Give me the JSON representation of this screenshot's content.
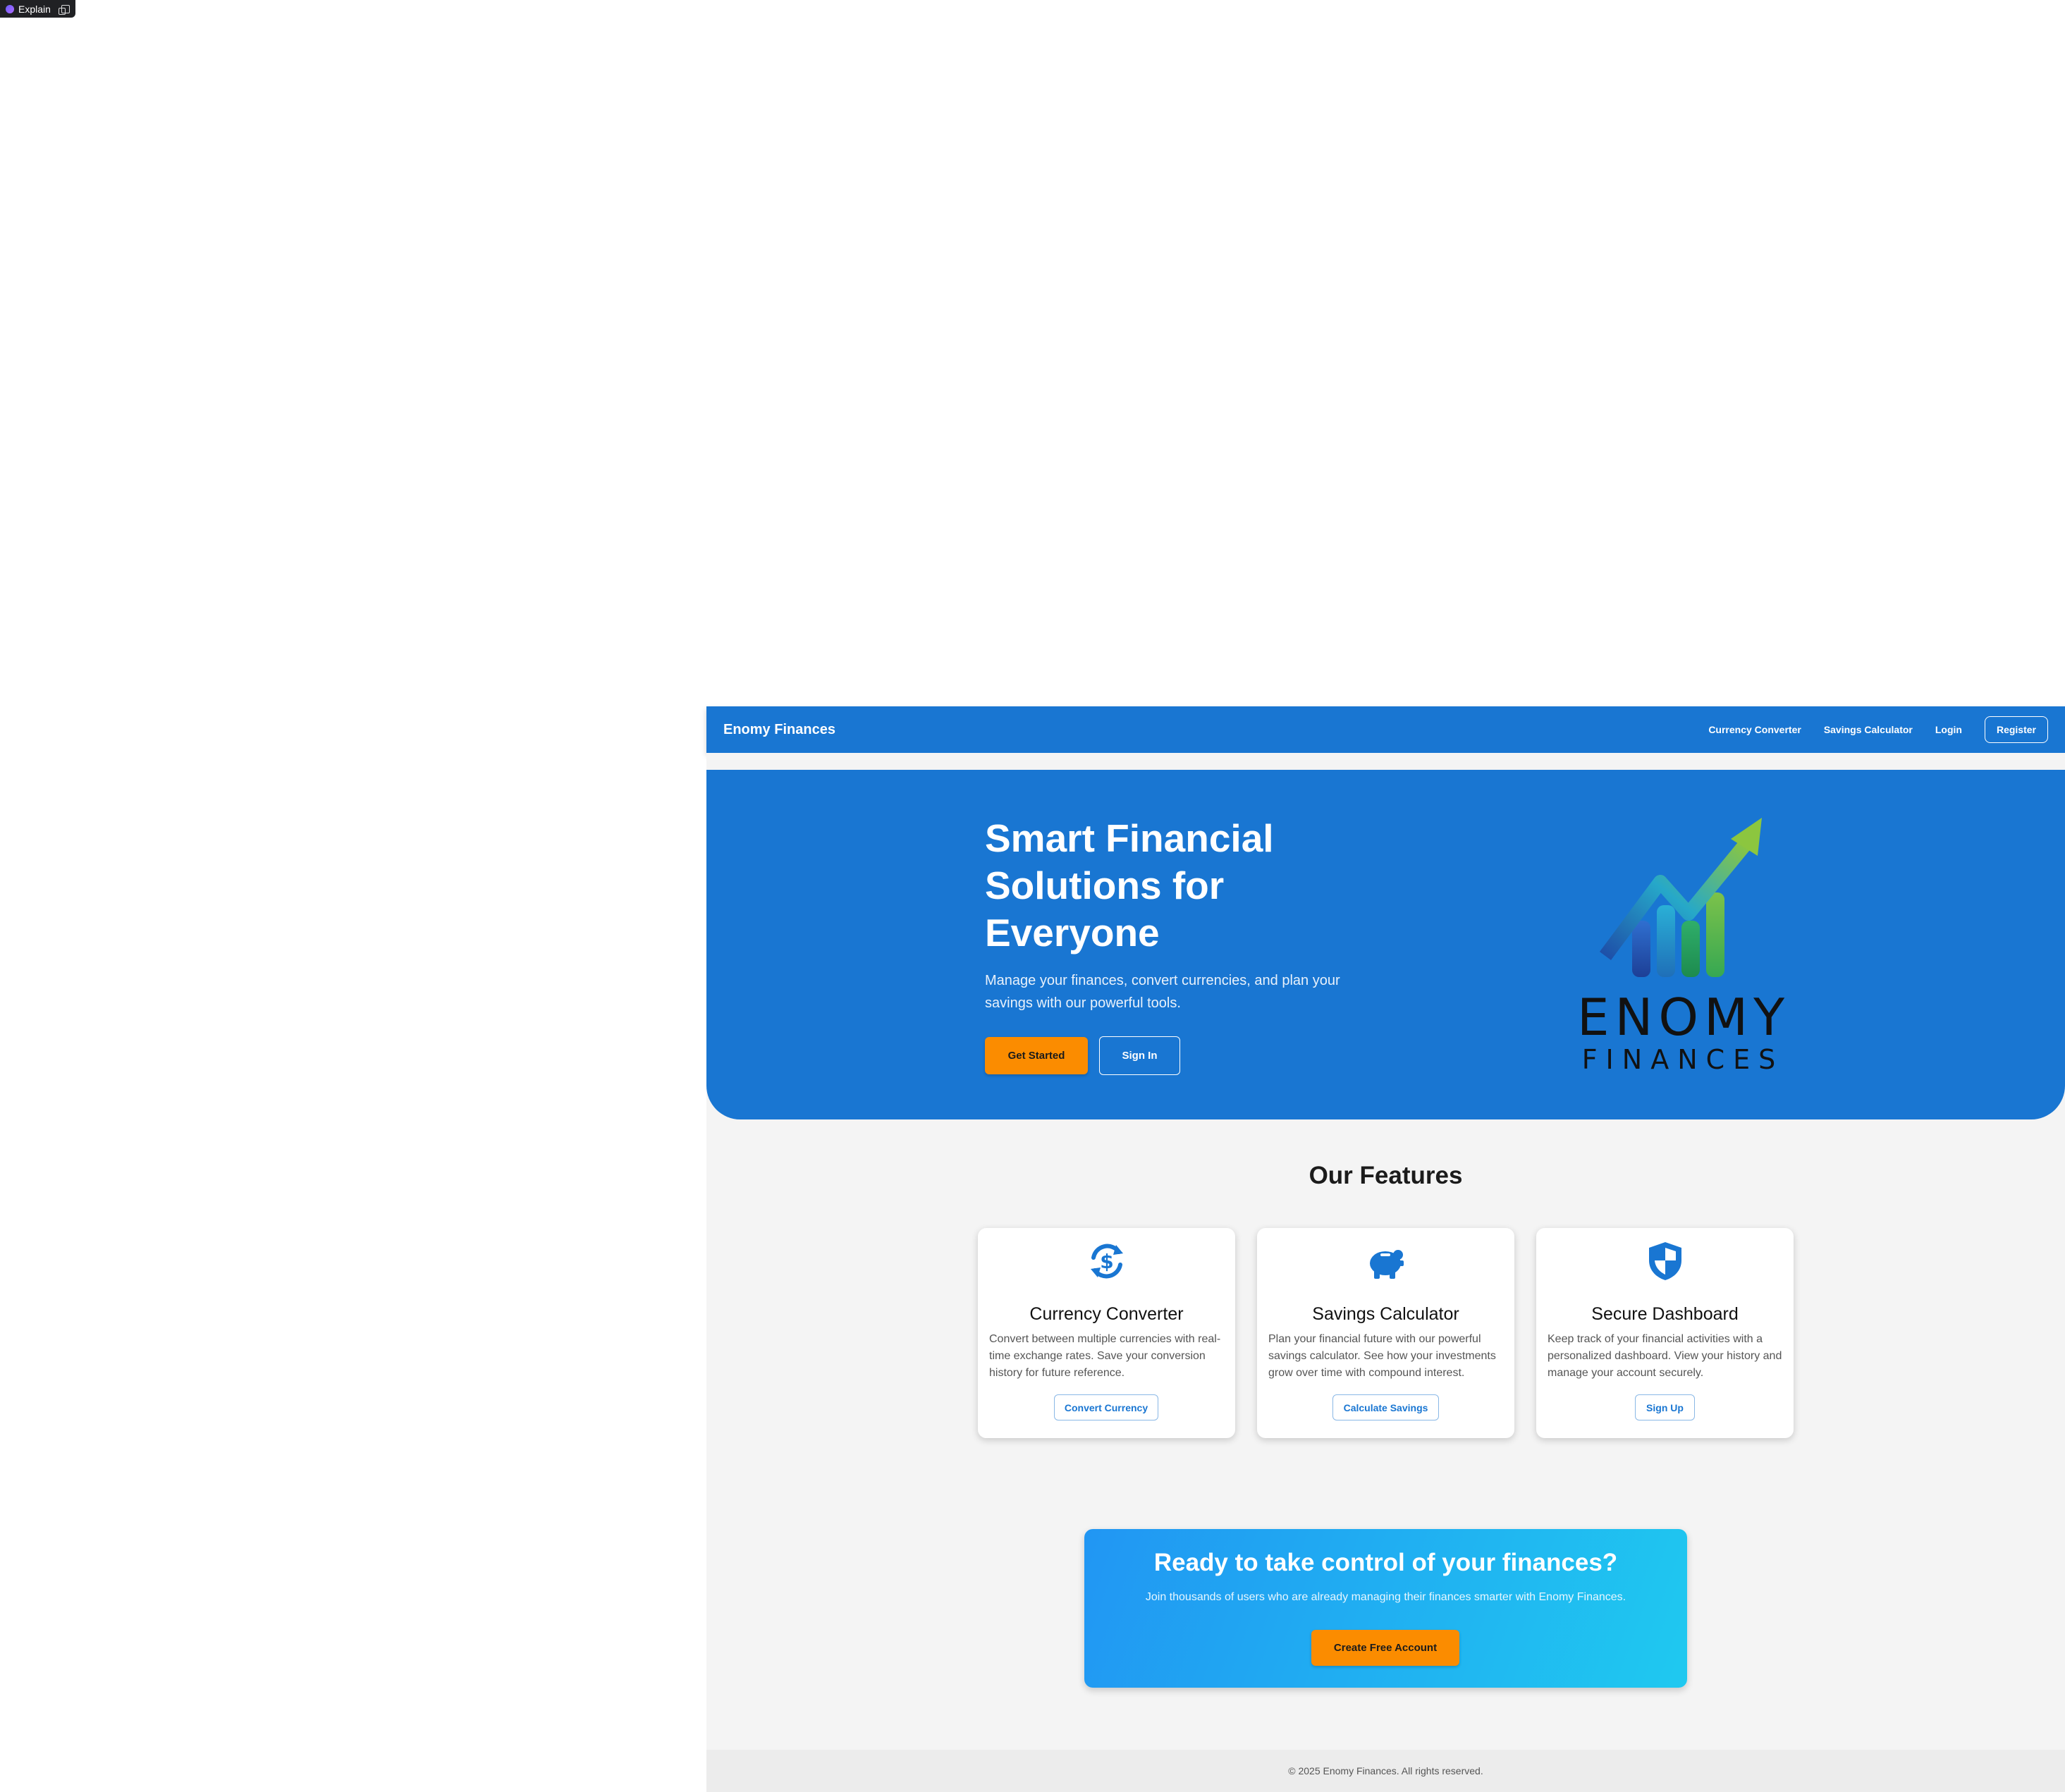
{
  "explain_badge": {
    "label": "Explain",
    "icon": "copy-icon"
  },
  "navbar": {
    "brand": "Enomy Finances",
    "links": [
      "Currency Converter",
      "Savings Calculator",
      "Login"
    ],
    "register_label": "Register"
  },
  "hero": {
    "title": "Smart Financial Solutions for Everyone",
    "subtitle": "Manage your finances, convert currencies, and plan your savings with our powerful tools.",
    "primary_button": "Get Started",
    "secondary_button": "Sign In",
    "logo": {
      "word1": "ENOMY",
      "word2": "FINANCES"
    }
  },
  "features": {
    "title": "Our Features",
    "cards": [
      {
        "icon": "currency-exchange-icon",
        "title": "Currency Converter",
        "description": "Convert between multiple currencies with real-time exchange rates. Save your conversion history for future reference.",
        "button": "Convert Currency"
      },
      {
        "icon": "piggy-bank-icon",
        "title": "Savings Calculator",
        "description": "Plan your financial future with our powerful savings calculator. See how your investments grow over time with compound interest.",
        "button": "Calculate Savings"
      },
      {
        "icon": "shield-icon",
        "title": "Secure Dashboard",
        "description": "Keep track of your financial activities with a personalized dashboard. View your history and manage your account securely.",
        "button": "Sign Up"
      }
    ]
  },
  "cta": {
    "title": "Ready to take control of your finances?",
    "subtitle": "Join thousands of users who are already managing their finances smarter with Enomy Finances.",
    "button": "Create Free Account"
  },
  "footer": {
    "text": "© 2025 Enomy Finances. All rights reserved."
  },
  "colors": {
    "primary": "#1976d2",
    "accent": "#fb8c00",
    "background": "#f4f4f4"
  }
}
